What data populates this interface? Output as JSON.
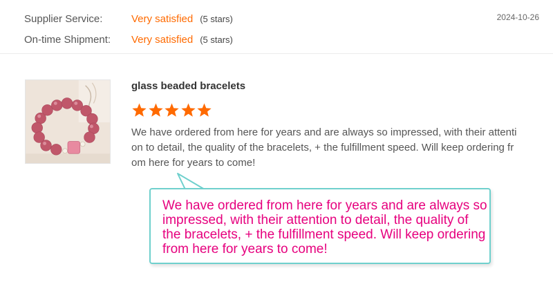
{
  "seller_ratings": [
    {
      "label": "Supplier Service:",
      "value": "Very satisfied",
      "stars_text": "(5 stars)"
    },
    {
      "label": "On-time Shipment:",
      "value": "Very satisfied",
      "stars_text": "(5 stars)"
    }
  ],
  "review": {
    "date": "2024-10-26",
    "product_title": "glass beaded bracelets",
    "rating": 5,
    "text": "We have ordered from here for years and are always so impressed, with their attention to detail, the quality of the bracelets, + the fulfillment speed. Will keep ordering from here for years to come!",
    "product_image_icon": "bracelet-photo"
  },
  "callout": {
    "text": "We have ordered from here for years and are always so impressed, with their attention to detail, the quality of the bracelets, + the fulfillment speed. Will keep ordering from here for years to come!"
  },
  "colors": {
    "accent_orange": "#ff6a00",
    "callout_border": "#6fd0cd",
    "callout_text": "#e6007e"
  }
}
